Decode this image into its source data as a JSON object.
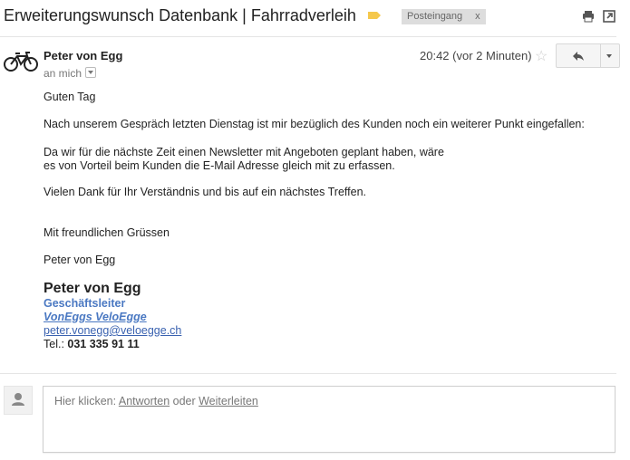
{
  "header": {
    "subject": "Erweiterungswunsch Datenbank | Fahrradverleih",
    "label": "Posteingang",
    "label_remove": "x",
    "label_color": "#f5c84c"
  },
  "message": {
    "sender": "Peter von Egg",
    "recipient_line": "an mich",
    "time": "20:42 (vor 2 Minuten)",
    "star": "☆",
    "body": {
      "greeting": "Guten Tag",
      "p1": "Nach unserem Gespräch letzten Dienstag ist mir bezüglich des Kunden noch ein weiterer Punkt eingefallen:",
      "p2_line1": "Da wir für die nächste Zeit einen Newsletter mit Angeboten geplant haben, wäre",
      "p2_line2": "es von Vorteil beim Kunden die E-Mail Adresse gleich mit zu erfassen.",
      "p3": "Vielen Dank für Ihr Verständnis und bis auf ein nächstes Treffen.",
      "closing": "Mit freundlichen Grüssen",
      "name": "Peter von Egg"
    },
    "signature": {
      "name": "Peter von Egg",
      "title": "Geschäftsleiter",
      "company": "VonEggs VeloEgge",
      "email": "peter.vonegg@veloegge.ch",
      "tel_label": "Tel.: ",
      "tel": "031 335 91 11"
    }
  },
  "reply": {
    "prefix": "Hier klicken: ",
    "reply_link": "Antworten",
    "or": " oder ",
    "forward_link": "Weiterleiten"
  },
  "icons": {
    "sender_avatar": "bicycle-icon",
    "print": "print-icon",
    "new_window": "new-window-icon",
    "reply": "reply-icon",
    "more": "chevron-down-icon",
    "reply_avatar": "person-icon",
    "label": "label-tag-icon"
  }
}
